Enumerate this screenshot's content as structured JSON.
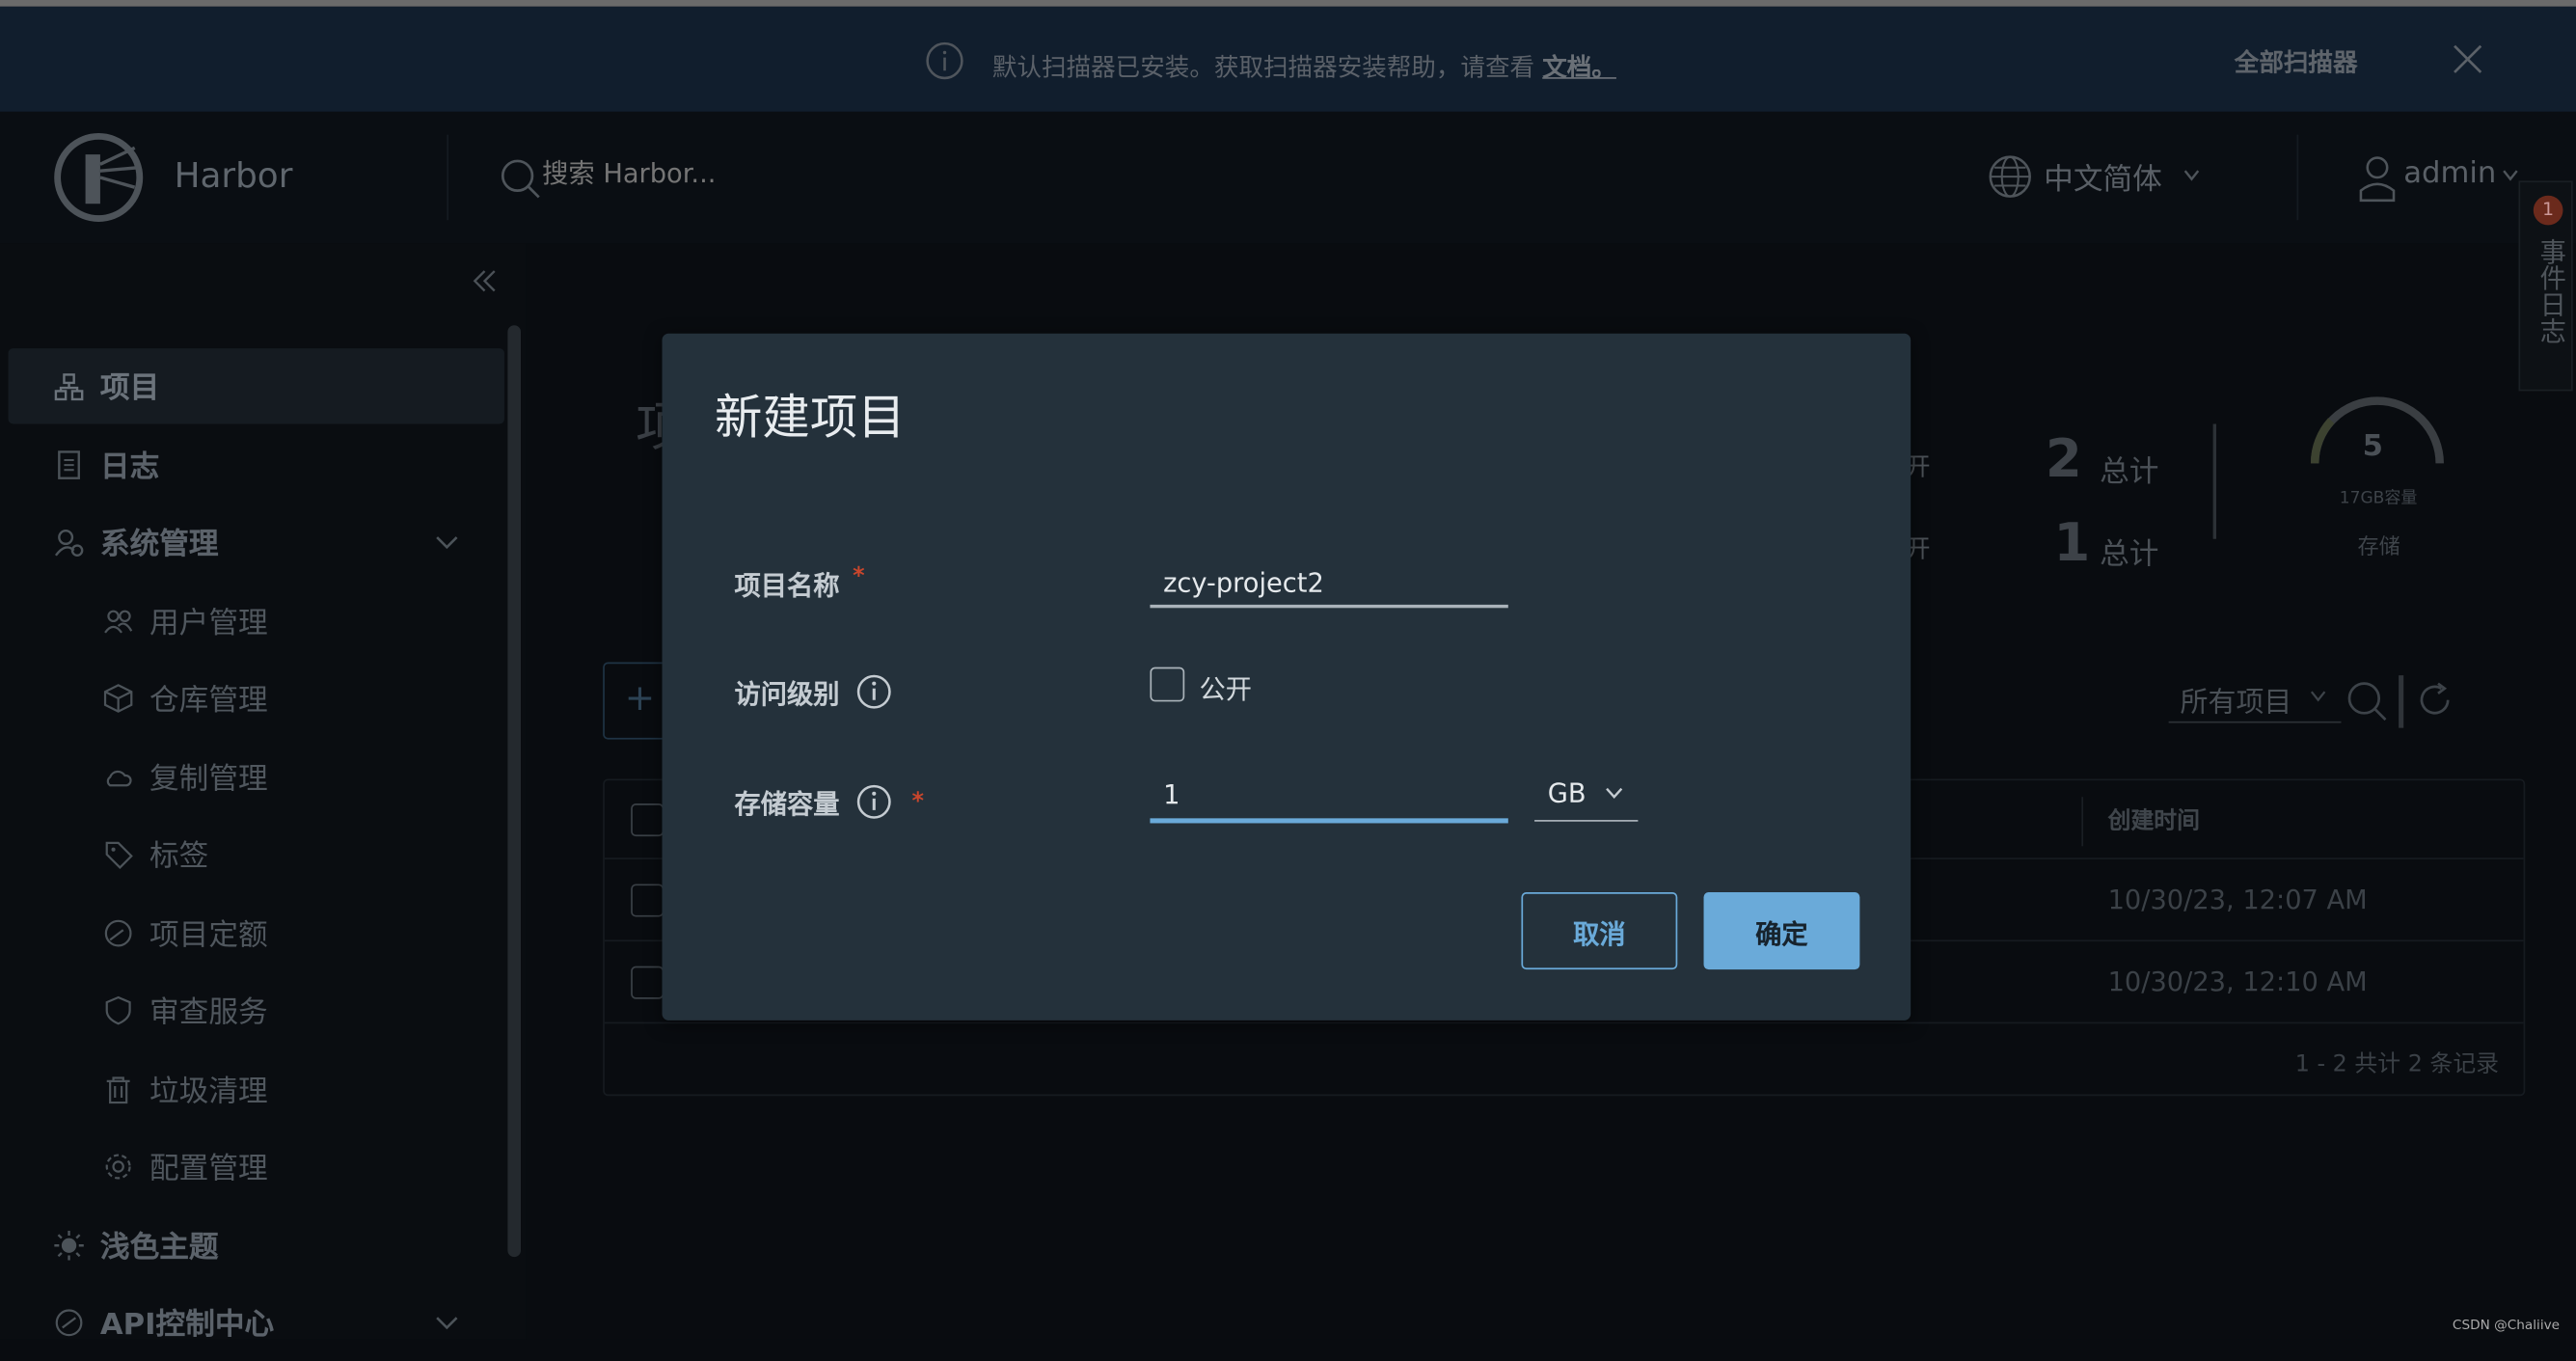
{
  "banner": {
    "message": "默认扫描器已安装。获取扫描器安装帮助，请查看",
    "doc_link": "文档。",
    "all_scanners": "全部扫描器"
  },
  "header": {
    "app_name": "Harbor",
    "search_placeholder": "搜索 Harbor...",
    "language": "中文简体",
    "user": "admin"
  },
  "event_log": {
    "label": "事件日志",
    "badge": "1"
  },
  "sidebar": {
    "items": [
      {
        "label": "项目",
        "icon": "projects-icon",
        "active": true
      },
      {
        "label": "日志",
        "icon": "logs-icon"
      },
      {
        "label": "系统管理",
        "icon": "admin-icon",
        "expandable": true
      },
      {
        "label": "用户管理",
        "icon": "users-icon",
        "sub": true
      },
      {
        "label": "仓库管理",
        "icon": "registry-icon",
        "sub": true
      },
      {
        "label": "复制管理",
        "icon": "replication-icon",
        "sub": true
      },
      {
        "label": "标签",
        "icon": "tag-icon",
        "sub": true
      },
      {
        "label": "项目定额",
        "icon": "quota-icon",
        "sub": true
      },
      {
        "label": "审查服务",
        "icon": "shield-icon",
        "sub": true
      },
      {
        "label": "垃圾清理",
        "icon": "trash-icon",
        "sub": true
      },
      {
        "label": "配置管理",
        "icon": "gear-icon",
        "sub": true
      },
      {
        "label": "浅色主题",
        "icon": "sun-icon"
      },
      {
        "label": "API控制中心",
        "icon": "api-icon",
        "expandable": true
      }
    ]
  },
  "main": {
    "title": "项目",
    "stats": [
      {
        "value": "2",
        "label": "总计",
        "prefix": "开"
      },
      {
        "value": "1",
        "label": "总计",
        "prefix": "开"
      }
    ],
    "storage": {
      "value": "5",
      "capacity": "17GB容量",
      "label": "存储"
    },
    "filter": "所有项目",
    "table": {
      "header_created": "创建时间",
      "rows": [
        {
          "created": "10/30/23, 12:07 AM"
        },
        {
          "created": "10/30/23, 12:10 AM"
        }
      ],
      "footer": "1 - 2 共计 2 条记录"
    }
  },
  "modal": {
    "title": "新建项目",
    "name_label": "项目名称",
    "name_value": "zcy-project2",
    "access_label": "访问级别",
    "public_label": "公开",
    "public_checked": false,
    "storage_label": "存储容量",
    "storage_value": "1",
    "storage_unit": "GB",
    "cancel": "取消",
    "ok": "确定"
  },
  "colors": {
    "accent": "#6aaad9",
    "modal_bg": "#24313b",
    "required": "#c9462c"
  },
  "watermark": "CSDN @Chaliive"
}
